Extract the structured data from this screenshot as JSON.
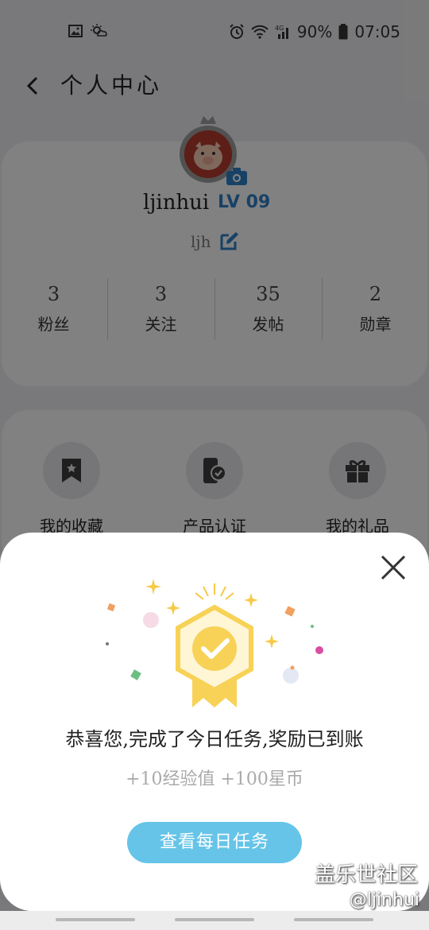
{
  "status_bar": {
    "battery": "90%",
    "time": "07:05"
  },
  "header": {
    "title": "个人中心"
  },
  "profile": {
    "username": "ljinhui",
    "level": "LV 09",
    "nickname": "ljh",
    "stats": [
      {
        "value": "3",
        "label": "粉丝"
      },
      {
        "value": "3",
        "label": "关注"
      },
      {
        "value": "35",
        "label": "发帖"
      },
      {
        "value": "2",
        "label": "勋章"
      }
    ]
  },
  "features": [
    {
      "label": "我的收藏",
      "icon": "bookmark-star-icon"
    },
    {
      "label": "产品认证",
      "icon": "phone-check-icon"
    },
    {
      "label": "我的礼品",
      "icon": "gift-icon"
    }
  ],
  "reward_dialog": {
    "message": "恭喜您,完成了今日任务,奖励已到账",
    "reward": "+10经验值 +100星币",
    "button": "查看每日任务",
    "accent_color": "#66c4e8",
    "badge_color": "#f7d257"
  },
  "watermark": {
    "site": "盖乐世社区",
    "user": "@ljinhui"
  }
}
